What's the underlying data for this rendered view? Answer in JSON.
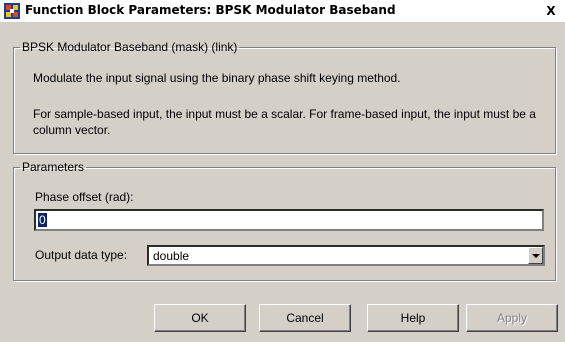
{
  "window": {
    "title": "Function Block Parameters: BPSK Modulator Baseband",
    "close_label": "X"
  },
  "mask_group": {
    "legend": "BPSK Modulator Baseband (mask) (link)",
    "description_1": "Modulate the input signal using the binary phase shift keying method.",
    "description_2": "For sample-based input, the input must be a scalar. For frame-based input, the input must be a column vector."
  },
  "parameters": {
    "legend": "Parameters",
    "phase_offset": {
      "label": "Phase offset (rad):",
      "value": "0"
    },
    "output_data_type": {
      "label": "Output data type:",
      "value": "double"
    }
  },
  "buttons": {
    "ok": "OK",
    "cancel": "Cancel",
    "help": "Help",
    "apply": "Apply"
  },
  "icons": {
    "title_icon": "simulink-block-icon",
    "dropdown_icon": "chevron-down-icon"
  },
  "colors": {
    "dialog_background": "#d4d0c8",
    "selection_highlight": "#0a246a"
  }
}
